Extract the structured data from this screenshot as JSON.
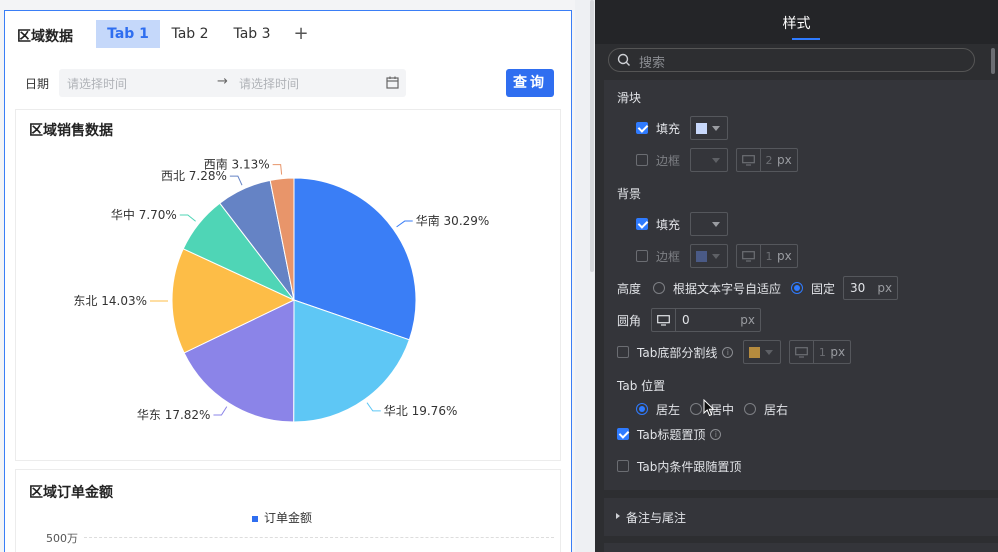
{
  "canvas": {
    "component_title": "区域数据",
    "tabs": [
      {
        "label": "Tab 1",
        "active": true
      },
      {
        "label": "Tab 2",
        "active": false
      },
      {
        "label": "Tab 3",
        "active": false
      }
    ],
    "add_tab_symbol": "+",
    "filter": {
      "date_label": "日期",
      "start_placeholder": "请选择时间",
      "end_placeholder": "请选择时间",
      "arrow": "→",
      "query_label": "查询"
    },
    "card1": {
      "title": "区域销售数据"
    },
    "card2": {
      "title": "区域订单金额",
      "legend": "订单金额",
      "y_tick": "500万"
    }
  },
  "chart_data": {
    "type": "pie",
    "title": "区域销售数据",
    "slices": [
      {
        "name": "华南",
        "value": 30.29,
        "label": "华南 30.29%",
        "color": "#3a7ef6"
      },
      {
        "name": "华北",
        "value": 19.76,
        "label": "华北 19.76%",
        "color": "#5ec7f5"
      },
      {
        "name": "华东",
        "value": 17.82,
        "label": "华东 17.82%",
        "color": "#8b84e8"
      },
      {
        "name": "东北",
        "value": 14.03,
        "label": "东北 14.03%",
        "color": "#fdbd47"
      },
      {
        "name": "华中",
        "value": 7.7,
        "label": "华中 7.70%",
        "color": "#4fd5b6"
      },
      {
        "name": "西北",
        "value": 7.28,
        "label": "西北 7.28%",
        "color": "#6583c5"
      },
      {
        "name": "西南",
        "value": 3.13,
        "label": "西南 3.13%",
        "color": "#e8956a"
      }
    ]
  },
  "panel": {
    "title": "样式",
    "search_placeholder": "搜索",
    "slider_section": "滑块",
    "slider_fill_label": "填充",
    "slider_fill_color": "#c8d8fb",
    "slider_border_label": "边框",
    "slider_border_width": "2",
    "background_section": "背景",
    "bg_fill_label": "填充",
    "bg_border_label": "边框",
    "bg_border_color": "#4a5a86",
    "bg_border_width": "1",
    "height_label": "高度",
    "height_auto_label": "根据文本字号自适应",
    "height_fixed_label": "固定",
    "height_value": "30",
    "radius_label": "圆角",
    "radius_value": "0",
    "divider_label": "Tab底部分割线",
    "divider_color": "#b58b3e",
    "divider_width": "1",
    "position_label": "Tab 位置",
    "pos_left": "居左",
    "pos_center": "居中",
    "pos_right": "居右",
    "title_sticky_label": "Tab标题置顶",
    "inner_sticky_label": "Tab内条件跟随置顶",
    "collapse_label": "备注与尾注",
    "unit": "px"
  }
}
